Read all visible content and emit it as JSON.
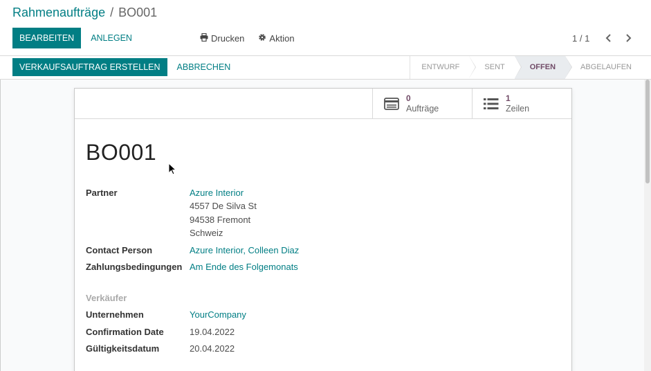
{
  "breadcrumb": {
    "parent": "Rahmenaufträge",
    "separator": "/",
    "current": "BO001"
  },
  "control_panel": {
    "edit_label": "BEARBEITEN",
    "create_label": "ANLEGEN",
    "print_label": "Drucken",
    "action_label": "Aktion",
    "pager_text": "1 / 1"
  },
  "statusbar": {
    "create_order_label": "VERKAUFSAUFTRAG ERSTELLEN",
    "cancel_label": "ABBRECHEN",
    "stages": [
      {
        "label": "ENTWURF",
        "active": false
      },
      {
        "label": "SENT",
        "active": false
      },
      {
        "label": "OFFEN",
        "active": true
      },
      {
        "label": "ABGELAUFEN",
        "active": false
      }
    ]
  },
  "smart_buttons": {
    "orders": {
      "value": "0",
      "label": "Aufträge",
      "icon": "sale-order-icon"
    },
    "lines": {
      "value": "1",
      "label": "Zeilen",
      "icon": "list-icon"
    }
  },
  "record": {
    "name": "BO001",
    "partner_label": "Partner",
    "partner_name": "Azure Interior",
    "partner_street": "4557 De Silva St",
    "partner_city": "94538 Fremont",
    "partner_country": "Schweiz",
    "contact_label": "Contact Person",
    "contact_value": "Azure Interior, Colleen Diaz",
    "payment_terms_label": "Zahlungsbedingungen",
    "payment_terms_value": "Am Ende des Folgemonats",
    "sales_group_title": "Verkäufer",
    "company_label": "Unternehmen",
    "company_value": "YourCompany",
    "confirmation_date_label": "Confirmation Date",
    "confirmation_date_value": "19.04.2022",
    "validity_date_label": "Gültigkeitsdatum",
    "validity_date_value": "20.04.2022"
  },
  "colors": {
    "primary": "#017e84",
    "accent": "#714b67",
    "active_stage_bg": "#e9ecef"
  }
}
